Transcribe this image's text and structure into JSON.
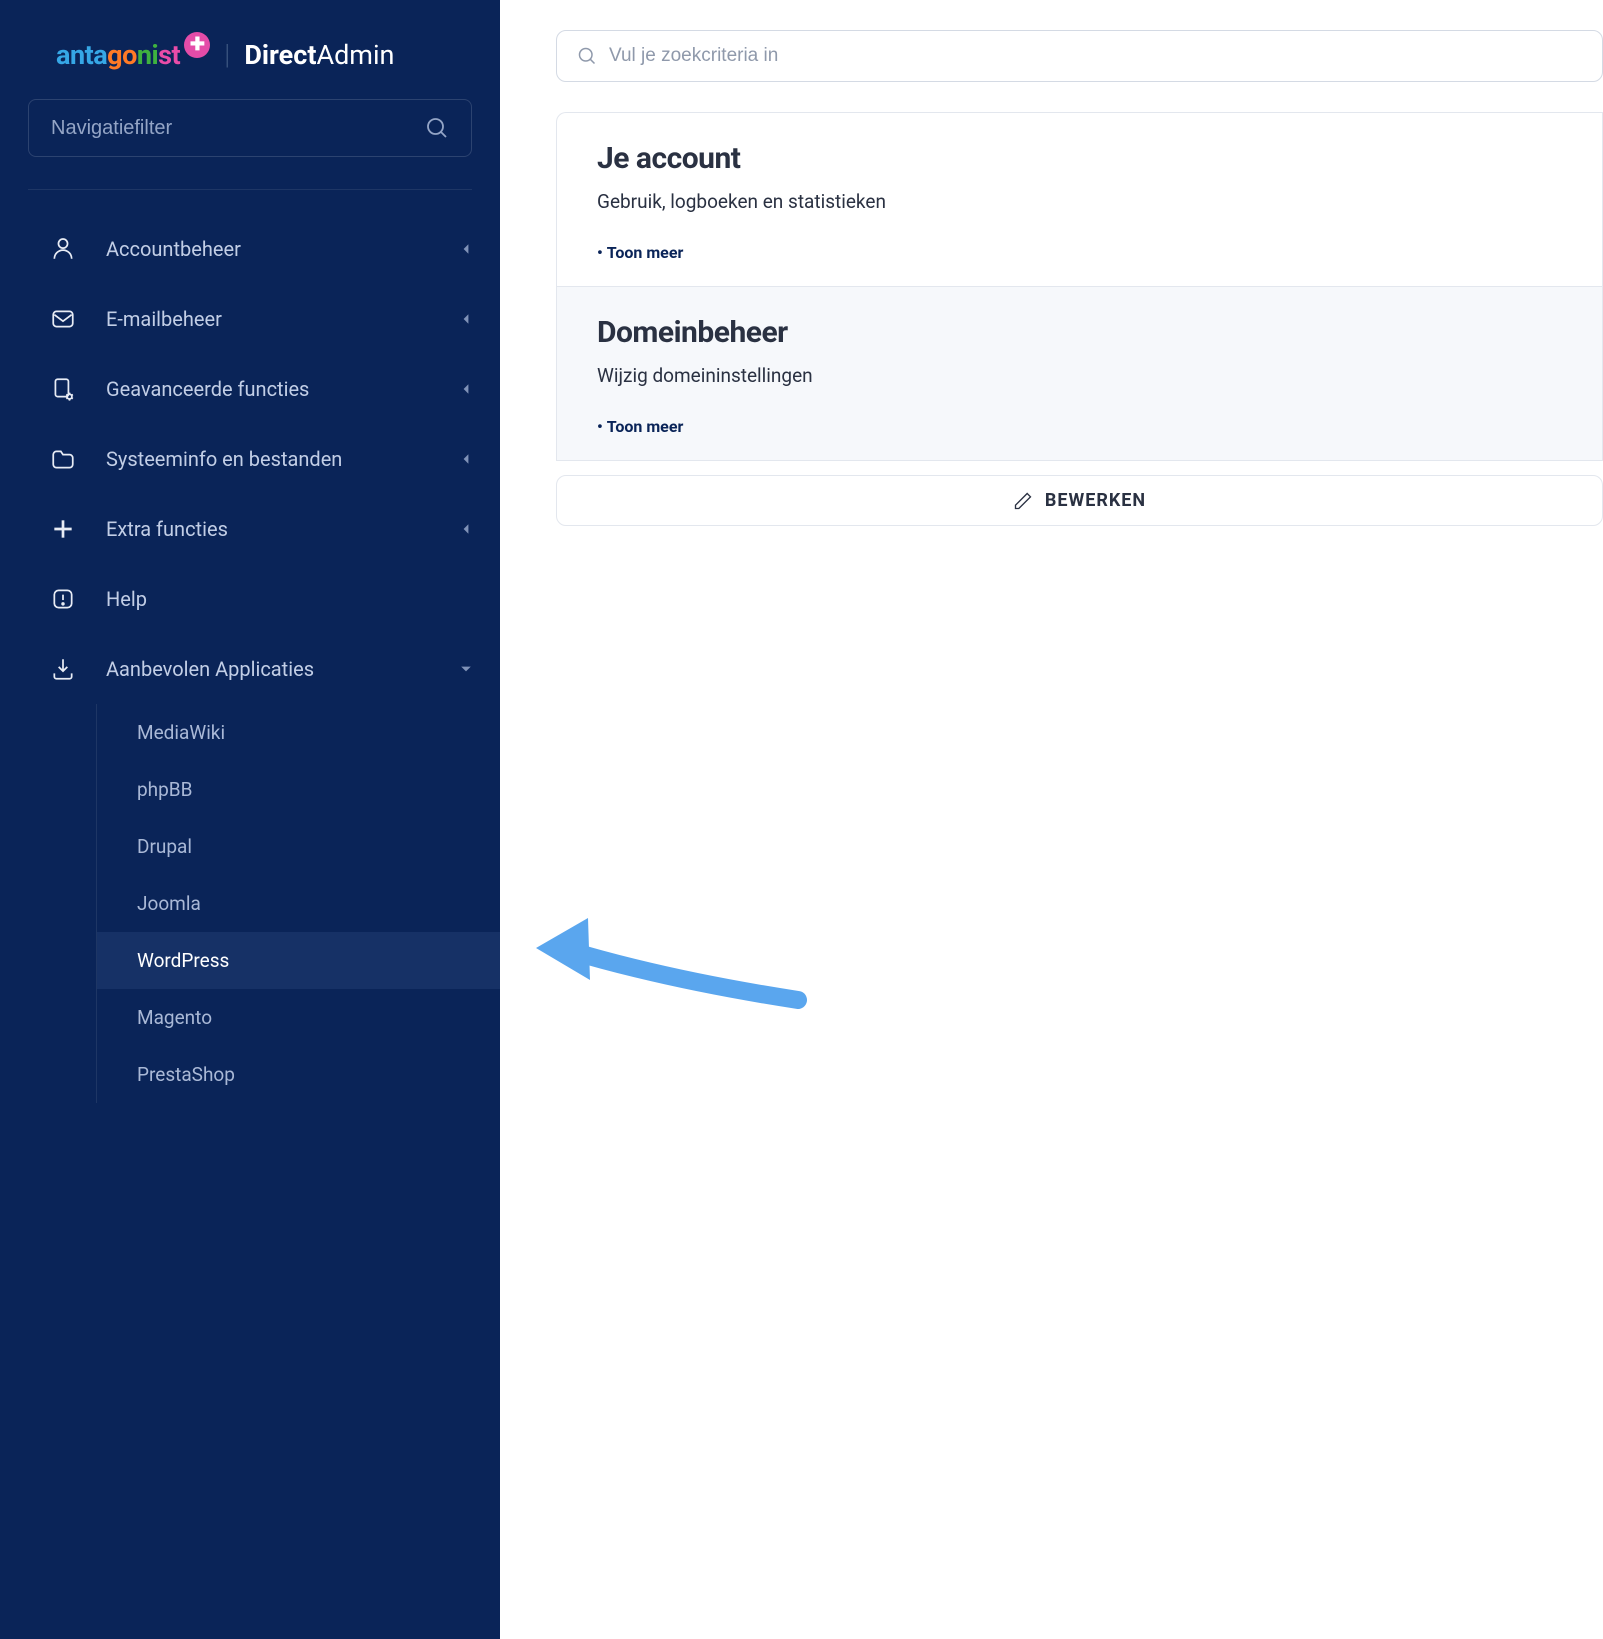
{
  "brand": {
    "antagonist_parts": [
      "anta",
      "go",
      "ni",
      "st"
    ],
    "product": "DirectAdmin"
  },
  "sidebar": {
    "filter_placeholder": "Navigatiefilter",
    "items": [
      {
        "id": "accountbeheer",
        "label": "Accountbeheer",
        "icon": "user",
        "expandable": true
      },
      {
        "id": "emailbeheer",
        "label": "E-mailbeheer",
        "icon": "mail",
        "expandable": true
      },
      {
        "id": "geavanceerd",
        "label": "Geavanceerde functies",
        "icon": "doc-gear",
        "expandable": true
      },
      {
        "id": "systeeminfo",
        "label": "Systeeminfo en bestanden",
        "icon": "folder",
        "expandable": true
      },
      {
        "id": "extra",
        "label": "Extra functies",
        "icon": "plus",
        "expandable": true
      },
      {
        "id": "help",
        "label": "Help",
        "icon": "alert",
        "expandable": false
      },
      {
        "id": "apps",
        "label": "Aanbevolen Applicaties",
        "icon": "download",
        "expandable": true,
        "expanded": true
      }
    ],
    "apps_submenu": [
      {
        "id": "mediawiki",
        "label": "MediaWiki"
      },
      {
        "id": "phpbb",
        "label": "phpBB"
      },
      {
        "id": "drupal",
        "label": "Drupal"
      },
      {
        "id": "joomla",
        "label": "Joomla"
      },
      {
        "id": "wordpress",
        "label": "WordPress",
        "active": true
      },
      {
        "id": "magento",
        "label": "Magento"
      },
      {
        "id": "prestashop",
        "label": "PrestaShop"
      }
    ]
  },
  "main": {
    "search_placeholder": "Vul je zoekcriteria in",
    "cards": [
      {
        "title": "Je account",
        "subtitle": "Gebruik, logboeken en statistieken",
        "show_more": "Toon meer"
      },
      {
        "title": "Domeinbeheer",
        "subtitle": "Wijzig domeininstellingen",
        "show_more": "Toon meer"
      }
    ],
    "edit_label": "BEWERKEN"
  }
}
